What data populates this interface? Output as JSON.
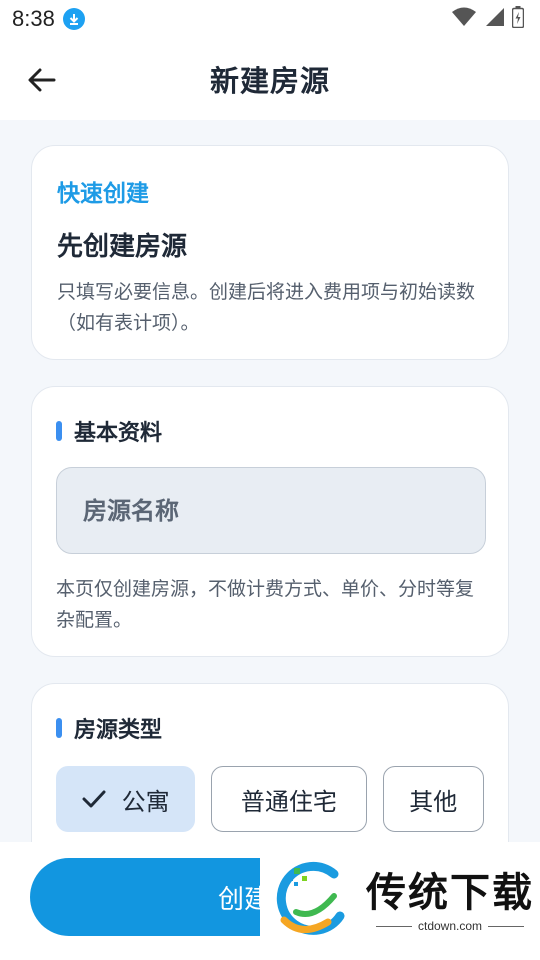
{
  "status": {
    "time": "8:38"
  },
  "header": {
    "title": "新建房源"
  },
  "quick": {
    "label": "快速创建",
    "title": "先创建房源",
    "desc": "只填写必要信息。创建后将进入费用项与初始读数（如有表计项）。"
  },
  "basic": {
    "title": "基本资料",
    "name_placeholder": "房源名称",
    "desc": "本页仅创建房源，不做计费方式、单价、分时等复杂配置。"
  },
  "type": {
    "title": "房源类型",
    "options": [
      "公寓",
      "普通住宅",
      "其他"
    ],
    "selected": "公寓"
  },
  "footer": {
    "create_label": "创建房源"
  },
  "watermark": {
    "brand": "传统下载",
    "url": "ctdown.com"
  },
  "colors": {
    "accent": "#1296e0",
    "label_blue": "#1e9be6",
    "chip_selected": "#d5e5f8"
  }
}
